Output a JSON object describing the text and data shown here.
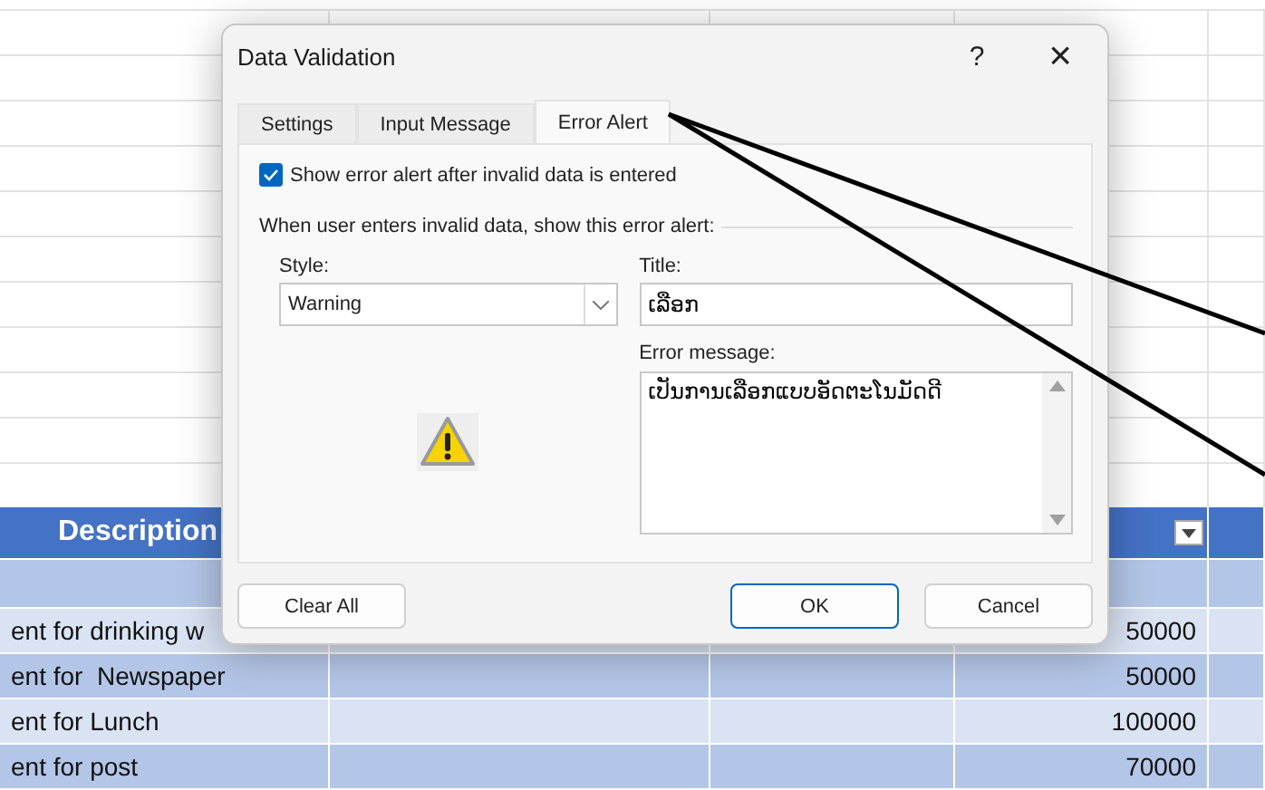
{
  "spreadsheet": {
    "header": {
      "description": "Description"
    },
    "rows": [
      {
        "description": "",
        "amount": ""
      },
      {
        "description": "ent for drinking w",
        "amount": "50000"
      },
      {
        "description": "ent for  Newspaper",
        "amount": "50000"
      },
      {
        "description": "ent for Lunch",
        "amount": "100000"
      },
      {
        "description": "ent for post",
        "amount": "70000"
      }
    ]
  },
  "dialog": {
    "title": "Data Validation",
    "help": "?",
    "close": "×",
    "tabs": [
      {
        "label": "Settings",
        "selected": false
      },
      {
        "label": "Input Message",
        "selected": false
      },
      {
        "label": "Error Alert",
        "selected": true
      }
    ],
    "show_error_alert": {
      "label": "Show error alert after invalid data is entered",
      "checked": true
    },
    "group_label": "When user enters invalid data, show this error alert:",
    "style": {
      "label": "Style:",
      "value": "Warning"
    },
    "title_field": {
      "label": "Title:",
      "value": "ເລືອກ"
    },
    "error_message": {
      "label": "Error message:",
      "value": "ເປັນການເລືອກແບບອັດຕະໂນມັດດີ"
    },
    "buttons": {
      "clear_all": "Clear All",
      "ok": "OK",
      "cancel": "Cancel"
    }
  }
}
